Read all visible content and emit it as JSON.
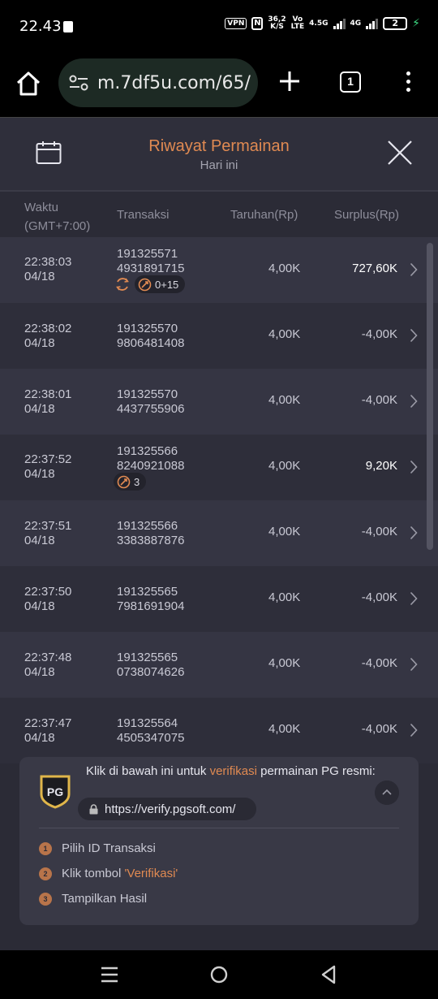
{
  "status_bar": {
    "time": "22.43",
    "vpn": "VPN",
    "nfc": "N",
    "speed_value": "36,2",
    "speed_unit": "K/S",
    "vo": "Vo",
    "lte": "LTE",
    "net1": "4.5G",
    "net2": "4G",
    "battery": "2"
  },
  "browser": {
    "url": "m.7df5u.com/65/",
    "tab_count": "1"
  },
  "modal": {
    "title": "Riwayat Permainan",
    "subtitle": "Hari ini"
  },
  "table": {
    "headers": {
      "time": "Waktu",
      "timezone": "(GMT+7:00)",
      "transaction": "Transaksi",
      "bet": "Taruhan(Rp)",
      "surplus": "Surplus(Rp)"
    },
    "rows": [
      {
        "time": "22:38:03",
        "date": "04/18",
        "trx1": "191325571",
        "trx2": "4931891715",
        "bet": "4,00K",
        "surplus": "727,60K",
        "positive": true,
        "badge_spin": true,
        "badge_free": "0+15"
      },
      {
        "time": "22:38:02",
        "date": "04/18",
        "trx1": "191325570",
        "trx2": "9806481408",
        "bet": "4,00K",
        "surplus": "-4,00K",
        "positive": false
      },
      {
        "time": "22:38:01",
        "date": "04/18",
        "trx1": "191325570",
        "trx2": "4437755906",
        "bet": "4,00K",
        "surplus": "-4,00K",
        "positive": false
      },
      {
        "time": "22:37:52",
        "date": "04/18",
        "trx1": "191325566",
        "trx2": "8240921088",
        "bet": "4,00K",
        "surplus": "9,20K",
        "positive": true,
        "badge_free": "3"
      },
      {
        "time": "22:37:51",
        "date": "04/18",
        "trx1": "191325566",
        "trx2": "3383887876",
        "bet": "4,00K",
        "surplus": "-4,00K",
        "positive": false
      },
      {
        "time": "22:37:50",
        "date": "04/18",
        "trx1": "191325565",
        "trx2": "7981691904",
        "bet": "4,00K",
        "surplus": "-4,00K",
        "positive": false
      },
      {
        "time": "22:37:48",
        "date": "04/18",
        "trx1": "191325565",
        "trx2": "0738074626",
        "bet": "4,00K",
        "surplus": "-4,00K",
        "positive": false
      },
      {
        "time": "22:37:47",
        "date": "04/18",
        "trx1": "191325564",
        "trx2": "4505347075",
        "bet": "4,00K",
        "surplus": "-4,00K",
        "positive": false
      }
    ]
  },
  "verify": {
    "logo_text": "PG",
    "line_prefix": "Klik di bawah ini untuk ",
    "line_link": "verifikasi",
    "line_suffix": " permainan PG resmi:",
    "url": "https://verify.pgsoft.com/",
    "steps": [
      {
        "num": "1",
        "text": "Pilih ID Transaksi",
        "highlight": ""
      },
      {
        "num": "2",
        "text": "Klik tombol ",
        "highlight": "'Verifikasi'"
      },
      {
        "num": "3",
        "text": "Tampilkan Hasil",
        "highlight": ""
      }
    ]
  },
  "colors": {
    "accent": "#e08a52",
    "bg": "#2b2b36",
    "row_odd": "#353543",
    "row_even": "#2e2e3a",
    "panel": "#393946"
  }
}
